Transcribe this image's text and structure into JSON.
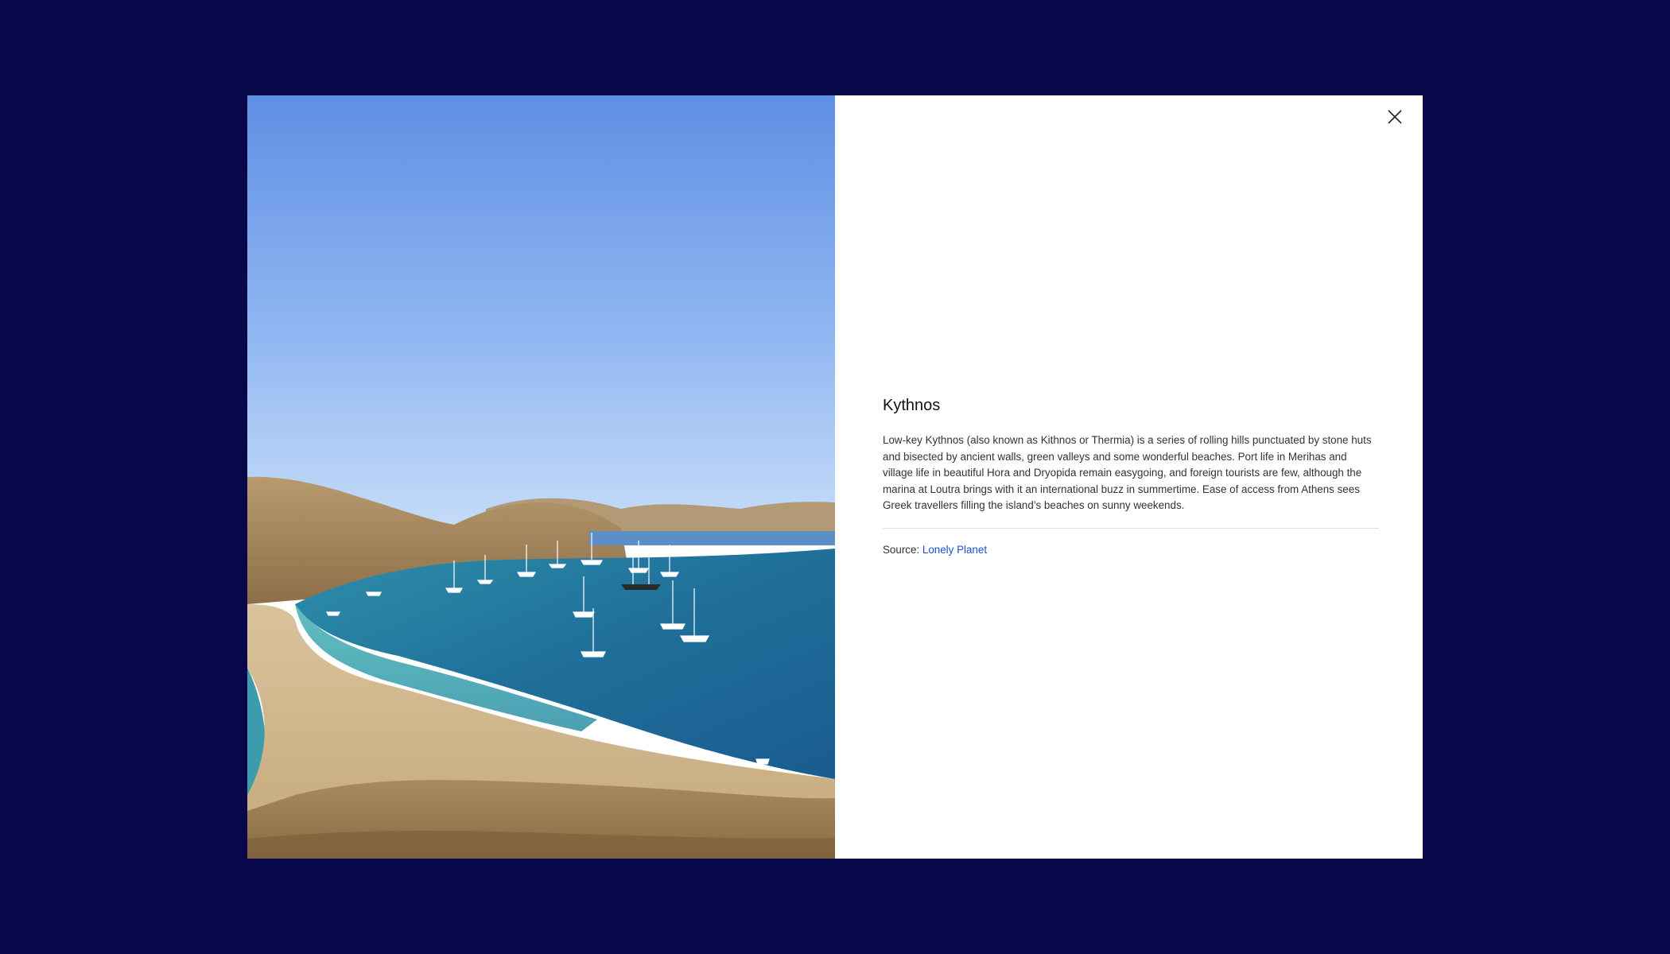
{
  "modal": {
    "photo": {
      "icon": "beach-bay-photo",
      "alt": "Kythnos"
    },
    "close_icon": "close-icon",
    "title": "Kythnos",
    "description": "Low-key Kythnos (also known as Kithnos or Thermia) is a series of rolling hills punctuated by stone huts and bisected by ancient walls, green valleys and some wonderful beaches. Port life in Merihas and village life in beautiful Hora and Dryopida remain easygoing, and foreign tourists are few, although the marina at Loutra brings with it an international buzz in summertime. Ease of access from Athens sees Greek travellers filling the island’s beaches on sunny weekends.",
    "source_label": "Source:",
    "source_link": "Lonely Planet"
  },
  "colors": {
    "backdrop": "#07074a",
    "link": "#1a4fd1",
    "panel": "#ffffff"
  }
}
